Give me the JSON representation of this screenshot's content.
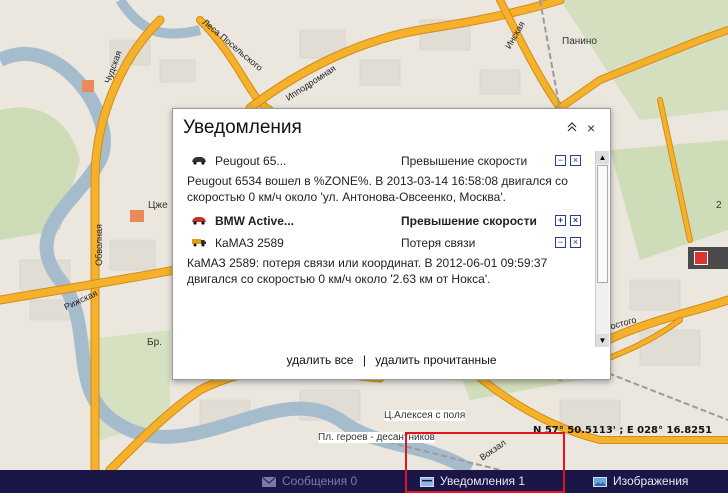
{
  "map": {
    "labels": {
      "panino": "Панино",
      "chudskaya": "Чудская",
      "lesa_poselskogo": "Леса Посельского",
      "ippodromnaya": "Ипподромная",
      "inskaya": "Инская",
      "obvodnaya": "Обволная",
      "rizhskaya": "Рижская",
      "tsh": "Цже",
      "br": "Бр.",
      "alekseya": "Ц.Алексея с поля",
      "pl_geroev": "Пл. героев - десантников",
      "vokzal": "Вокзал",
      "ostogo": "остого",
      "two": "2"
    },
    "coords_readout": "N 57° 50.5113' ; E 028° 16.8251"
  },
  "popup": {
    "title": "Уведомления",
    "collapse_glyph": "≈",
    "close_glyph": "×",
    "notifications": [
      {
        "vehicle": "Peugout 65...",
        "event": "Превышение скорости",
        "ctrl_a": "−",
        "ctrl_b": "×",
        "bold": false,
        "icon": "car-icon",
        "icon_color": "#333333",
        "body": "Peugout 6534 вошел в %ZONE%. В 2013-03-14 16:58:08 двигался со скоростью 0 км/ч около 'ул. Антонова-Овсеенко, Москва'."
      },
      {
        "vehicle": "BMW Active...",
        "event": "Превышение скорости",
        "ctrl_a": "+",
        "ctrl_b": "×",
        "bold": true,
        "icon": "car-icon",
        "icon_color": "#c8302a",
        "body": ""
      },
      {
        "vehicle": "КаМАЗ 2589",
        "event": "Потеря связи",
        "ctrl_a": "−",
        "ctrl_b": "×",
        "bold": false,
        "icon": "truck-icon",
        "icon_color": "#d9a010",
        "body": "КаМАЗ 2589: потеря связи или координат. В 2012-06-01 09:59:37 двигался со скоростью 0 км/ч около '2.63 км от Нокса'."
      }
    ],
    "footer": {
      "delete_all": "удалить все",
      "separator": "|",
      "delete_read": "удалить прочитанные"
    }
  },
  "bottombar": {
    "messages": "Сообщения 0",
    "notifications": "Уведомления  1",
    "images": "Изображения"
  },
  "colors": {
    "road": "#f5b12c",
    "road_border": "#d28d12",
    "river": "#9fb6c7",
    "green": "#c9d9b0",
    "bar": "#1a1748",
    "highlight": "#e4141d"
  }
}
